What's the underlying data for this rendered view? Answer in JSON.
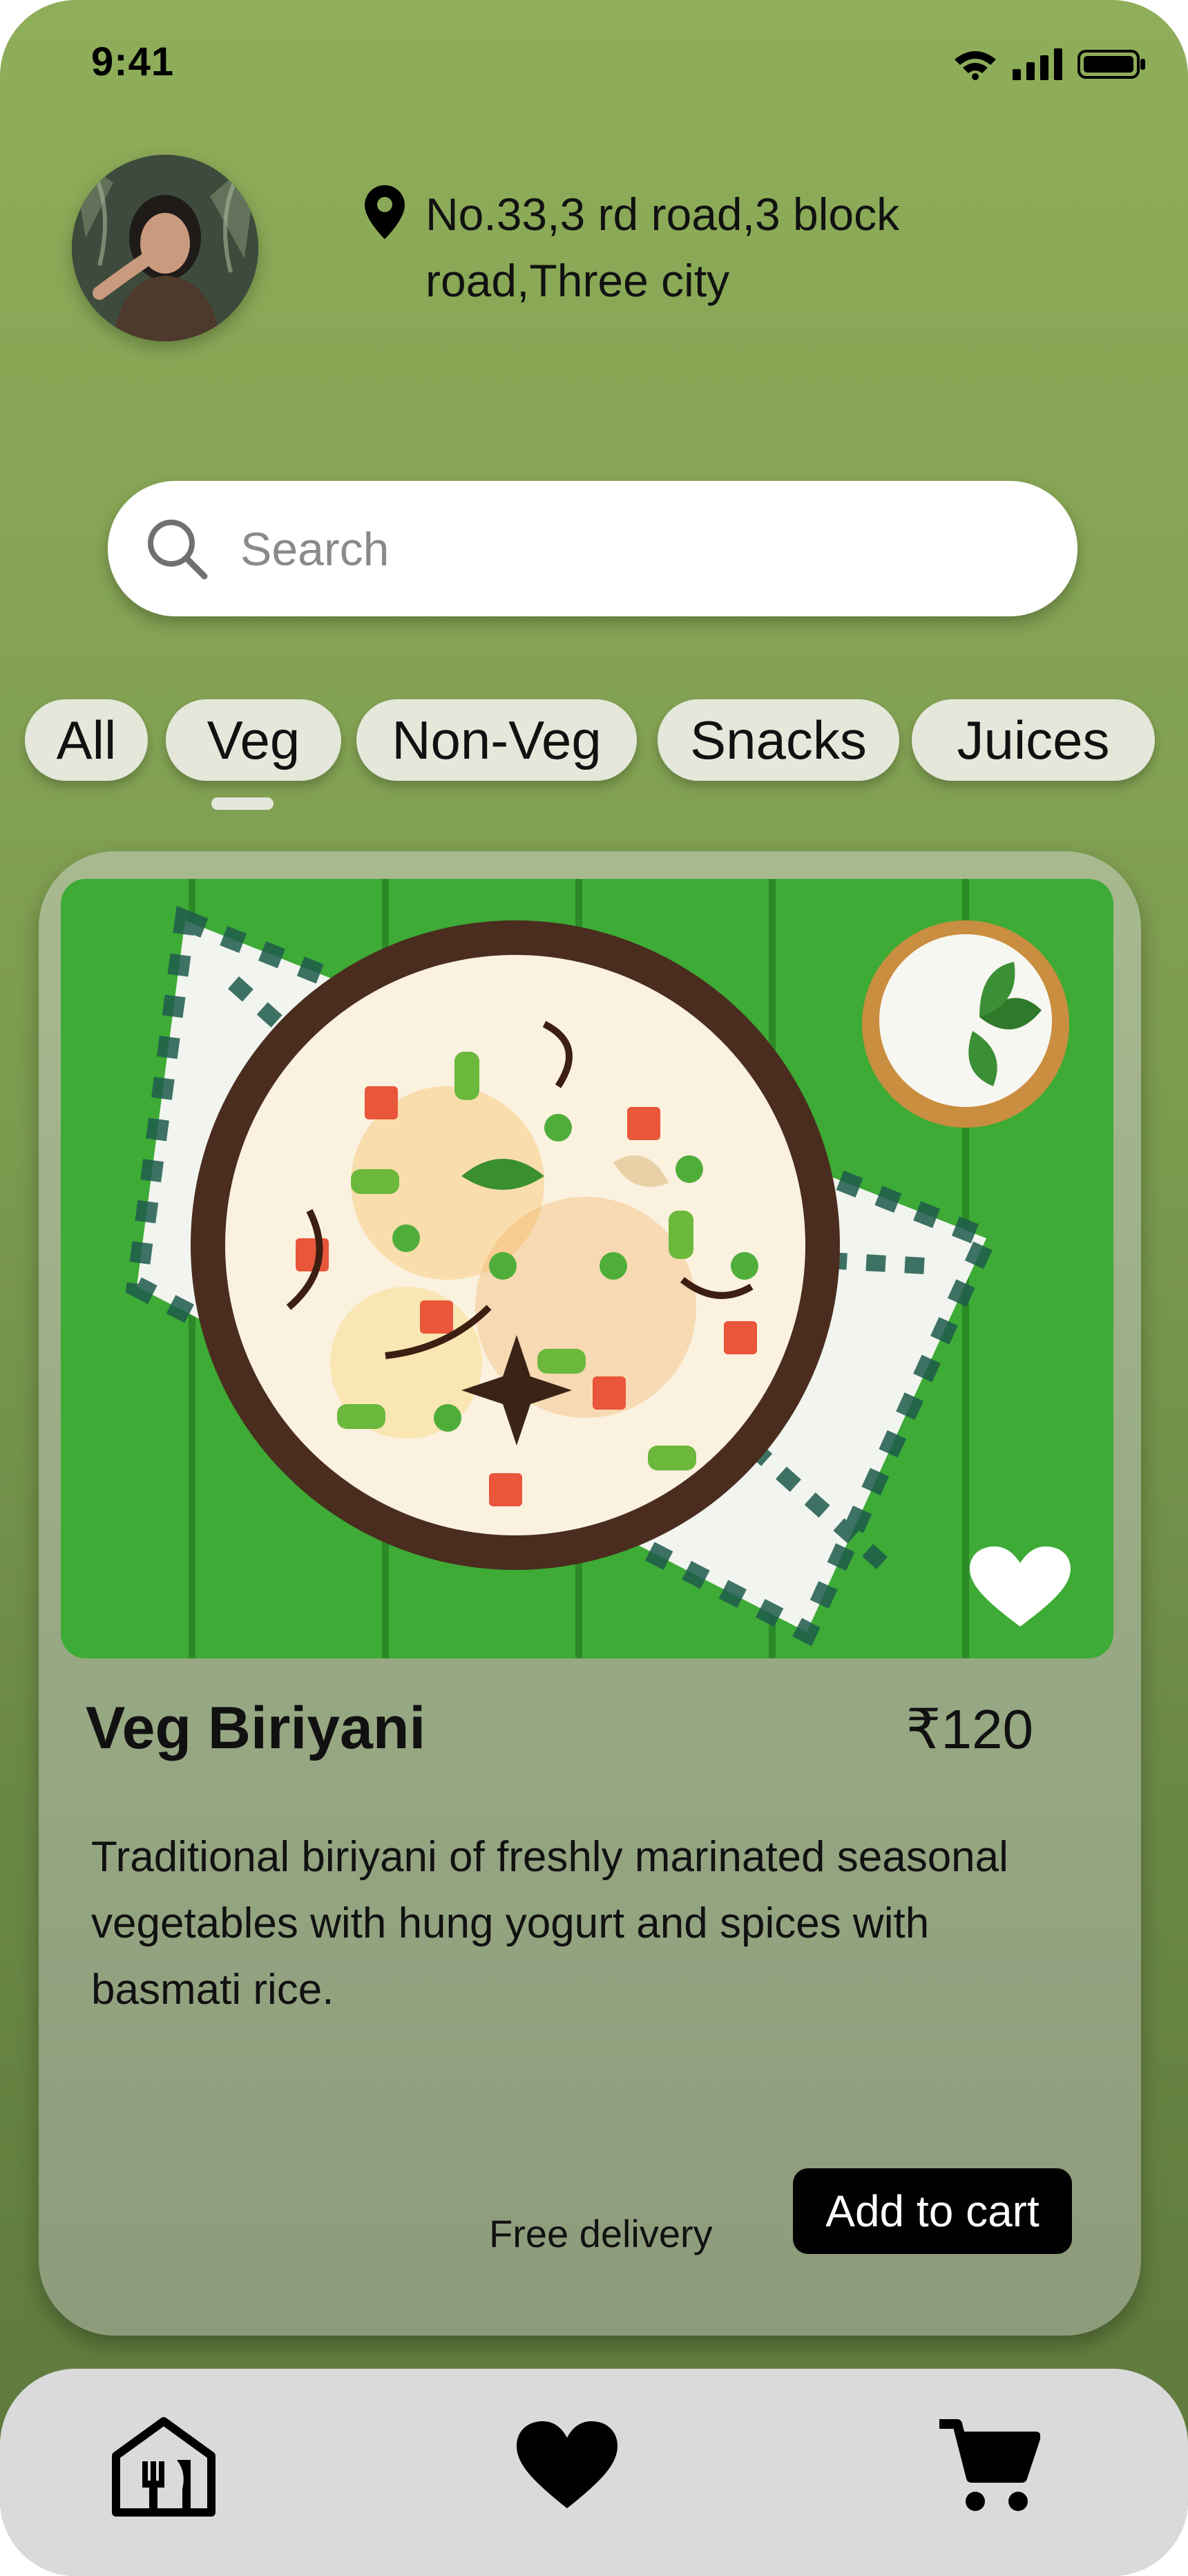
{
  "status_bar": {
    "time": "9:41"
  },
  "header": {
    "address_line1": "No.33,3 rd road,3 block",
    "address_line2": "road,Three city"
  },
  "search": {
    "placeholder": "Search"
  },
  "categories": [
    {
      "label": "All"
    },
    {
      "label": "Veg",
      "selected": true
    },
    {
      "label": "Non-Veg"
    },
    {
      "label": "Snacks"
    },
    {
      "label": "Juices"
    }
  ],
  "food": {
    "name": "Veg Biriyani",
    "price": "₹120",
    "description": "Traditional biriyani of freshly marinated seasonal vegetables with hung yogurt and spices with basmati rice.",
    "delivery": "Free delivery",
    "add_to_cart": "Add to cart"
  },
  "bottom_nav": {
    "items": [
      {
        "icon": "restaurant-home-icon"
      },
      {
        "icon": "heart-icon"
      },
      {
        "icon": "cart-icon"
      }
    ]
  },
  "colors": {
    "background_top": "#8fae5a",
    "background_bottom": "#5c783b",
    "card": "#9aad86",
    "chip": "#e4e7da",
    "nav": "#dadada",
    "button": "#000000"
  }
}
